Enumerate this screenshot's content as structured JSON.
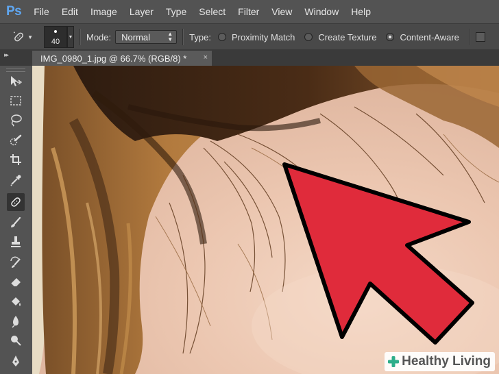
{
  "app": {
    "logo": "Ps"
  },
  "menubar": {
    "items": [
      "File",
      "Edit",
      "Image",
      "Layer",
      "Type",
      "Select",
      "Filter",
      "View",
      "Window",
      "Help"
    ]
  },
  "options": {
    "brush_size": "40",
    "mode_label": "Mode:",
    "mode_value": "Normal",
    "type_label": "Type:",
    "radios": [
      {
        "label": "Proximity Match",
        "checked": false
      },
      {
        "label": "Create Texture",
        "checked": false
      },
      {
        "label": "Content-Aware",
        "checked": true
      }
    ]
  },
  "document": {
    "tab_title": "IMG_0980_1.jpg @ 66.7% (RGB/8) *",
    "close": "×"
  },
  "toolbar": {
    "active_tool": "spot-healing-brush-icon",
    "tools": [
      "move-icon",
      "rectangular-marquee-icon",
      "lasso-icon",
      "quick-selection-icon",
      "crop-icon",
      "eyedropper-icon",
      "spot-healing-brush-icon",
      "brush-icon",
      "clone-stamp-icon",
      "history-brush-icon",
      "eraser-icon",
      "paint-bucket-icon",
      "blur-icon",
      "dodge-icon",
      "pen-icon"
    ]
  },
  "annotation": {
    "arrow_color": "#e02b3b",
    "outline_color": "#000000"
  },
  "watermark": {
    "text": "Healthy Living",
    "icon": "plus-leaf-icon",
    "color": "#2eae8a"
  }
}
